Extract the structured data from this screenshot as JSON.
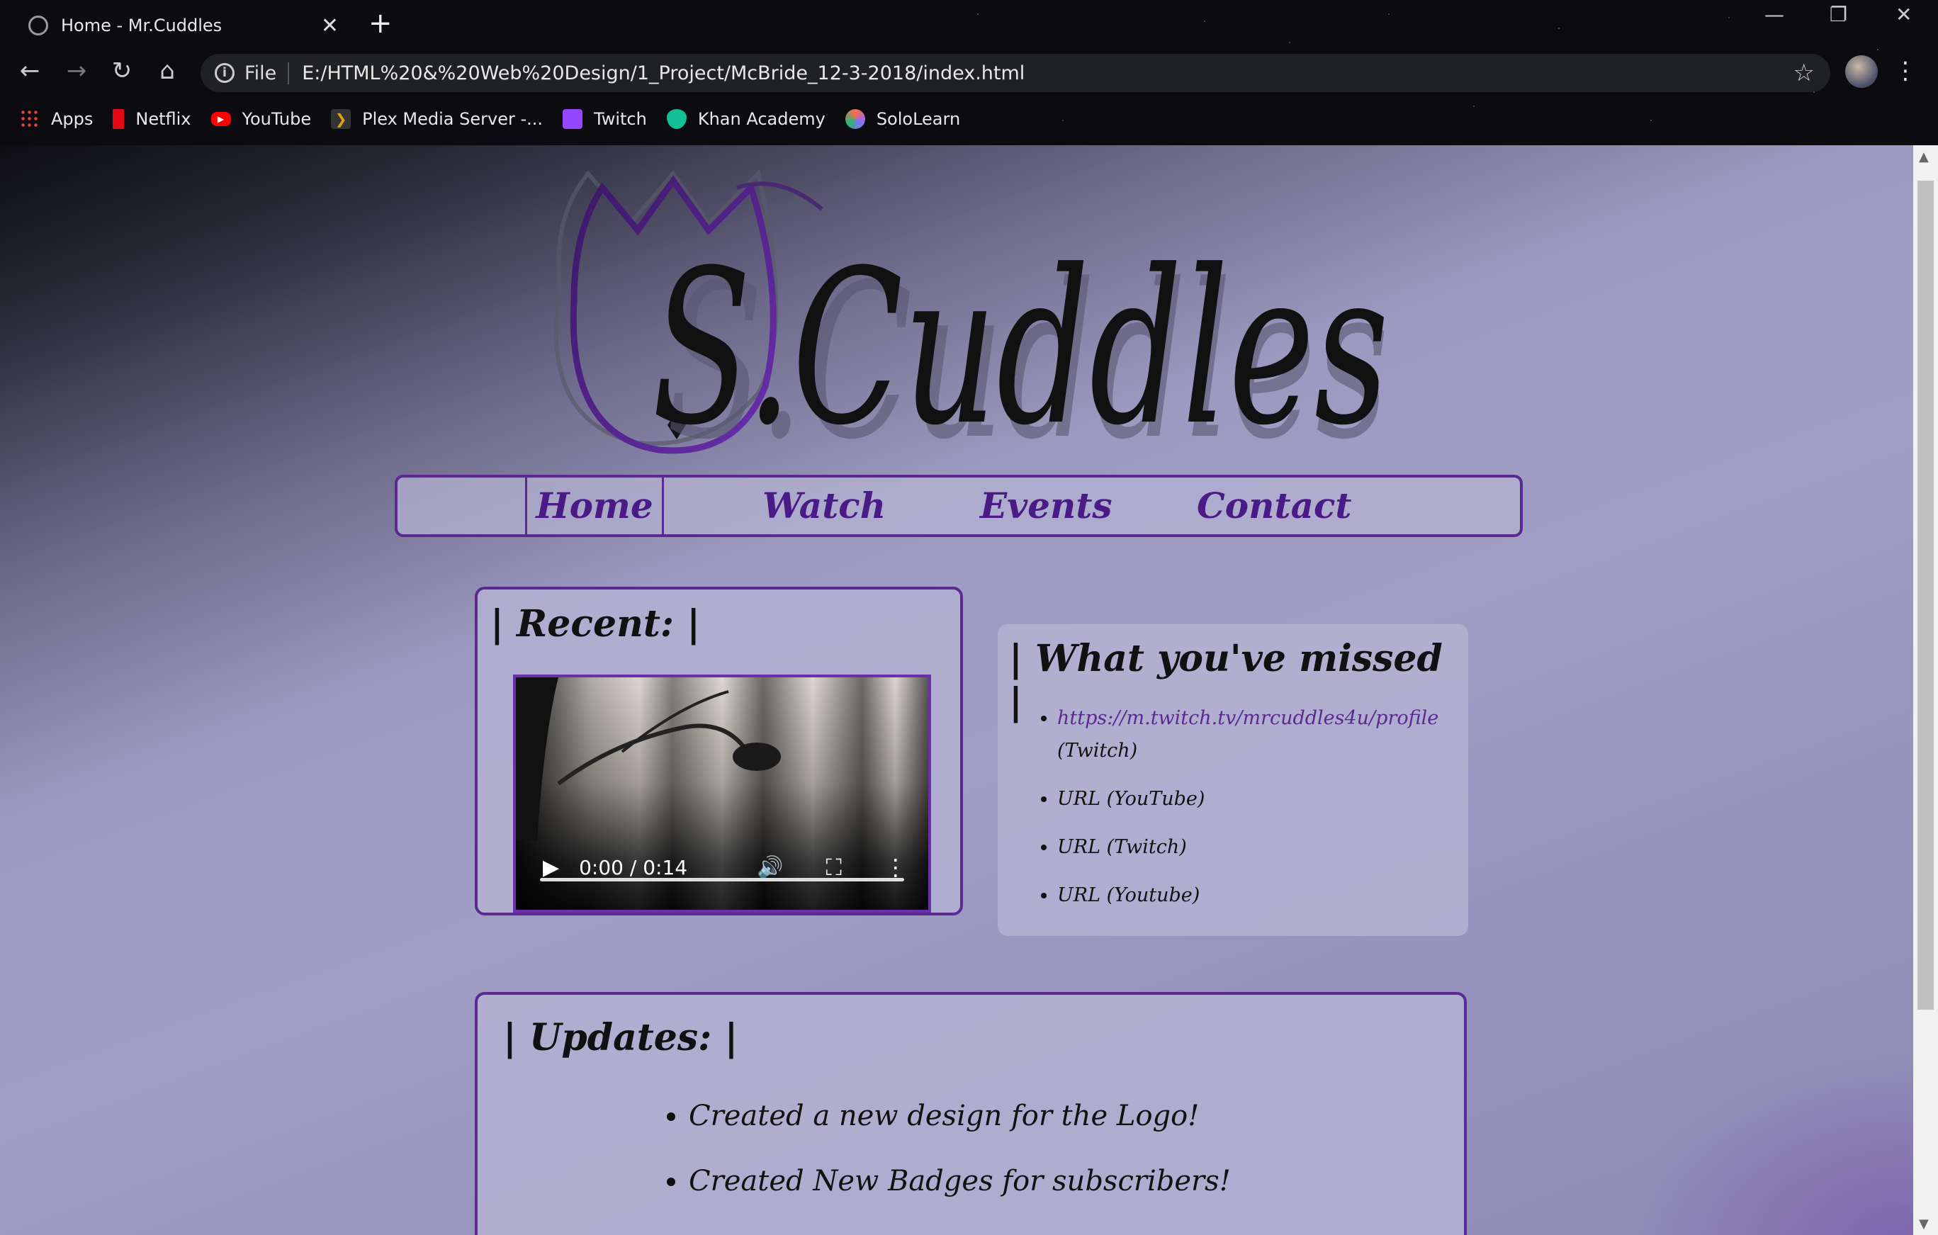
{
  "browser": {
    "tab_title": "Home - Mr.Cuddles",
    "address_prefix": "File",
    "url": "E:/HTML%20&%20Web%20Design/1_Project/McBride_12-3-2018/index.html",
    "bookmarks": [
      {
        "label": "Apps",
        "icon": "apps-grid-icon",
        "color": "#e94235"
      },
      {
        "label": "Netflix",
        "icon": "netflix-icon",
        "color": "#e50914"
      },
      {
        "label": "YouTube",
        "icon": "youtube-icon",
        "color": "#ff0000"
      },
      {
        "label": "Plex Media Server -...",
        "icon": "plex-icon",
        "color": "#e5a00d"
      },
      {
        "label": "Twitch",
        "icon": "twitch-icon",
        "color": "#9146ff"
      },
      {
        "label": "Khan Academy",
        "icon": "khan-academy-icon",
        "color": "#14bf96"
      },
      {
        "label": "SoloLearn",
        "icon": "sololearn-icon",
        "color": "#ff6b4a"
      }
    ]
  },
  "site": {
    "logo_text": "S.Cuddles",
    "nav": [
      "Home",
      "Watch",
      "Events",
      "Contact"
    ],
    "recent": {
      "heading": "| Recent: |",
      "video_time": "0:00 / 0:14"
    },
    "missed": {
      "heading": "| What you've missed |",
      "items": [
        {
          "link": "https://m.twitch.tv/mrcuddles4u/profile",
          "suffix": "(Twitch)"
        },
        {
          "text": "URL (YouTube)"
        },
        {
          "text": "URL (Twitch)"
        },
        {
          "text": "URL (Youtube)"
        }
      ]
    },
    "updates": {
      "heading": "| Updates: |",
      "items": [
        "Created a new design for the Logo!",
        "Created New Badges for subscribers!"
      ]
    }
  },
  "colors": {
    "accent_purple": "#5b2a91",
    "page_lavender": "#a09ec4"
  }
}
